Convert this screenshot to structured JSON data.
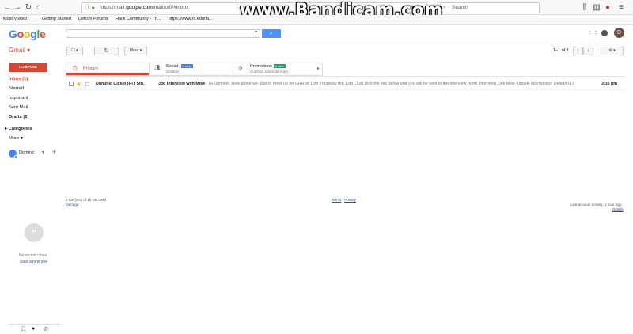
{
  "browser": {
    "url_prefix": "https://mail.",
    "url_domain": "google.com",
    "url_suffix": "/mail/u/0/#inbox",
    "search_placeholder": "Search",
    "bookmarks": [
      "Most Visited",
      "Getting Started",
      "Defcon Forums",
      "Hack Community - Th...",
      "https://www.rit.edu/fa..."
    ],
    "icons": [
      "back-icon",
      "forward-icon",
      "reload-icon",
      "home-icon",
      "info-icon",
      "lock-icon",
      "reader-icon",
      "bookmark-star-icon",
      "pocket-icon",
      "download-icon",
      "library-icon",
      "sidebar-icon",
      "notifications-icon",
      "menu-icon"
    ]
  },
  "watermark": "www.Bandicam.com",
  "gmail": {
    "logo": "Google",
    "logo_colors": [
      "#4285f4",
      "#ea4335",
      "#fbbc05",
      "#4285f4",
      "#34a853",
      "#ea4335"
    ],
    "label": "Gmail ▾",
    "avatar_letter": "D",
    "toolbar": {
      "more_label": "More ▾",
      "pagination": "1–1 of 1"
    },
    "compose_label": "COMPOSE",
    "nav": [
      {
        "label": "Inbox (1)",
        "color": "#dd4b39",
        "bold": true
      },
      {
        "label": "Starred",
        "color": "#222",
        "bold": false
      },
      {
        "label": "Important",
        "color": "#222",
        "bold": false
      },
      {
        "label": "Sent Mail",
        "color": "#222",
        "bold": false
      },
      {
        "label": "Drafts (1)",
        "color": "#222",
        "bold": true
      }
    ],
    "categories_label": "Categories",
    "more_label": "More ▾",
    "chat_user": "Dominic",
    "tabs": [
      {
        "title": "Primary",
        "subtitle": "",
        "badge": ""
      },
      {
        "title": "Social",
        "subtitle": "Dribbble",
        "badge": "1 new"
      },
      {
        "title": "Promotions",
        "subtitle": "Grubhub, Evernote Team",
        "badge": "6 new"
      }
    ],
    "email": {
      "sender": "Dominic Cicilio (RIT Stu.",
      "subject": "Job Interview with Mike",
      "snippet": " - Hi Dominic, How about we plan to meet up on GRR at 1pm Thursday the 12th. Just click the link below and you will be sent to the interview room. Interview Link Mike Kinoski Microgozon Design LLl",
      "time": "3:35 pm",
      "starred": true
    },
    "footer": {
      "storage": "0 GB (0%) of 15 GB used",
      "manage": "Manage",
      "terms": "Terms",
      "separator": " - ",
      "privacy": "Privacy",
      "activity": "Last account activity: 1 hour ago",
      "details": "Details"
    },
    "chat": {
      "no_chats": "No recent chats",
      "start_new": "Start a new one"
    }
  }
}
